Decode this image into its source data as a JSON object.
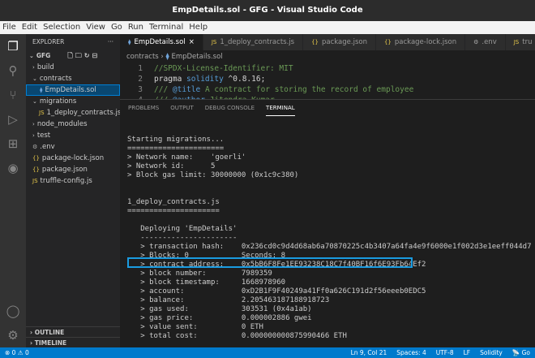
{
  "window": {
    "title": "EmpDetails.sol - GFG - Visual Studio Code"
  },
  "menu": [
    "File",
    "Edit",
    "Selection",
    "View",
    "Go",
    "Run",
    "Terminal",
    "Help"
  ],
  "sidebar": {
    "title": "EXPLORER",
    "more": "···",
    "root": "GFG",
    "items": [
      {
        "label": "build",
        "indent": 1,
        "type": "folder-closed"
      },
      {
        "label": "contracts",
        "indent": 1,
        "type": "folder-open"
      },
      {
        "label": "EmpDetails.sol",
        "indent": 2,
        "type": "sol",
        "selected": true
      },
      {
        "label": "migrations",
        "indent": 1,
        "type": "folder-open"
      },
      {
        "label": "1_deploy_contracts.js",
        "indent": 2,
        "type": "js"
      },
      {
        "label": "node_modules",
        "indent": 1,
        "type": "folder-closed"
      },
      {
        "label": "test",
        "indent": 1,
        "type": "folder-closed"
      },
      {
        "label": ".env",
        "indent": 1,
        "type": "env"
      },
      {
        "label": "package-lock.json",
        "indent": 1,
        "type": "json"
      },
      {
        "label": "package.json",
        "indent": 1,
        "type": "json"
      },
      {
        "label": "truffle-config.js",
        "indent": 1,
        "type": "js"
      }
    ],
    "outline": "OUTLINE",
    "timeline": "TIMELINE"
  },
  "tabs": [
    {
      "label": "EmpDetails.sol",
      "icon": "sol",
      "active": true
    },
    {
      "label": "1_deploy_contracts.js",
      "icon": "js"
    },
    {
      "label": "package.json",
      "icon": "json"
    },
    {
      "label": "package-lock.json",
      "icon": "json"
    },
    {
      "label": ".env",
      "icon": "gear"
    },
    {
      "label": "tru",
      "icon": "js"
    }
  ],
  "breadcrumb": [
    "contracts",
    "EmpDetails.sol"
  ],
  "code": [
    {
      "n": "1",
      "parts": [
        [
          "//SPDX-License-Identifier: MIT",
          "#6a9955"
        ]
      ]
    },
    {
      "n": "2",
      "parts": [
        [
          "pragma ",
          "#d4d4d4"
        ],
        [
          "solidity",
          "#569cd6"
        ],
        [
          " ^0.8.16;",
          "#d4d4d4"
        ]
      ]
    },
    {
      "n": "3",
      "parts": [
        [
          "/// ",
          "#6a9955"
        ],
        [
          "@title",
          "#569cd6"
        ],
        [
          " A contract for storing the record of employee",
          "#6a9955"
        ]
      ]
    },
    {
      "n": "4",
      "parts": [
        [
          "/// ",
          "#6a9955"
        ],
        [
          "@author",
          "#569cd6"
        ],
        [
          " Jitendra Kumar",
          "#6a9955"
        ]
      ]
    }
  ],
  "panel": {
    "tabs": [
      "PROBLEMS",
      "OUTPUT",
      "DEBUG CONSOLE",
      "TERMINAL"
    ],
    "active": "TERMINAL"
  },
  "terminal": "Starting migrations...\n======================\n> Network name:    'goerli'\n> Network id:      5\n> Block gas limit: 30000000 (0x1c9c380)\n\n\n1_deploy_contracts.js\n=====================\n\n   Deploying 'EmpDetails'\n   ----------------------\n   > transaction hash:    0x236cd0c9d4d68ab6a70870225c4b3407a64fa4e9f6000e1f002d3e1eeff044d7\n   > Blocks: 0            Seconds: 8\n   > contract address:    0x5bB6F8Fe1EE93238C18C7f40BF16f6E93Fb64Ef2\n   > block number:        7989359\n   > block timestamp:     1668978960\n   > account:             0xD2B1F9F40249a41Ff0a626C191d2f56eeeb0EDC5\n   > balance:             2.205463187188918723\n   > gas used:            303531 (0x4a1ab)\n   > gas price:           0.000002886 gwei\n   > value sent:          0 ETH\n   > total cost:          0.000000000875990466 ETH",
  "status": {
    "errors": "0",
    "warnings": "0",
    "position": "Ln 9, Col 21",
    "spaces": "Spaces: 4",
    "encoding": "UTF-8",
    "eol": "LF",
    "language": "Solidity",
    "golive": "Go"
  },
  "colors": {
    "accent": "#007acc",
    "highlight": "#1a9be0"
  }
}
